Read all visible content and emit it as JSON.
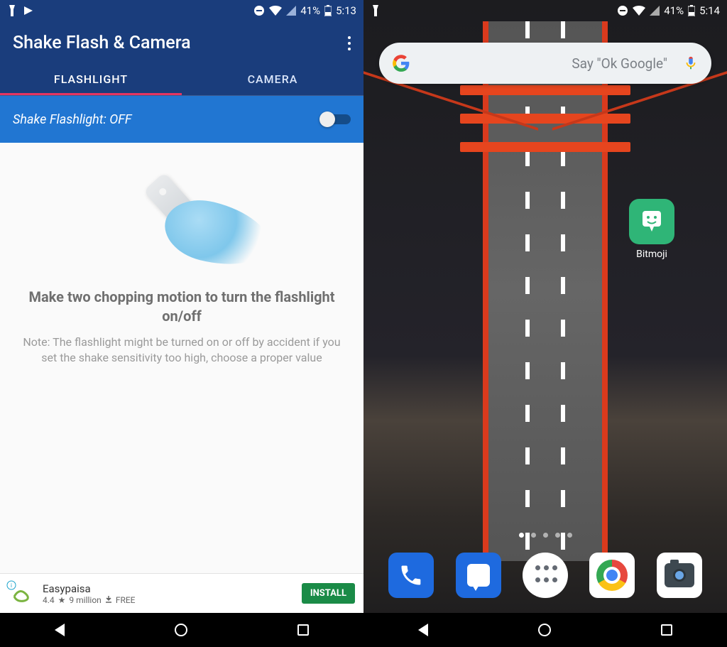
{
  "left": {
    "statusbar": {
      "battery": "41%",
      "time": "5:13"
    },
    "app_title": "Shake Flash & Camera",
    "tabs": {
      "flashlight": "FLASHLIGHT",
      "camera": "CAMERA"
    },
    "toggle_label": "Shake Flashlight: OFF",
    "headline": "Make two chopping motion to turn the flashlight on/off",
    "note": "Note: The flashlight might be turned on or off by accident if you set the shake sensitivity too high, choose a proper value",
    "ad": {
      "title": "Easypaisa",
      "rating": "4.4",
      "downloads": "9 million",
      "price": "FREE",
      "button": "INSTALL"
    }
  },
  "right": {
    "statusbar": {
      "battery": "41%",
      "time": "5:14"
    },
    "search_placeholder": "Say \"Ok Google\"",
    "apps": {
      "bitmoji": "Bitmoji"
    }
  }
}
